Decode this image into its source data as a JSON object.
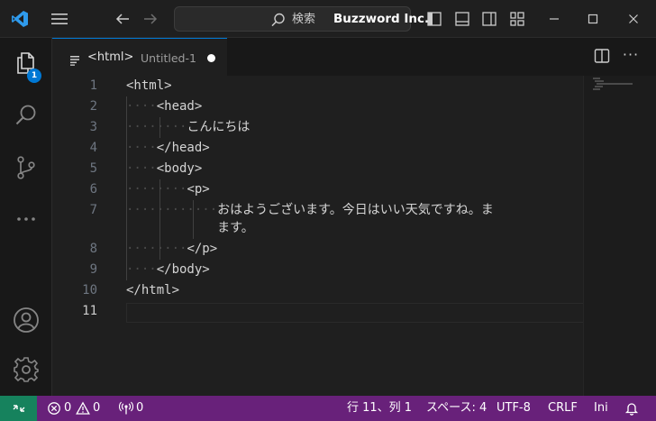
{
  "titlebar": {
    "search_label": "検索",
    "title": "Buzzword Inc."
  },
  "activity": {
    "explorer_badge": "1"
  },
  "tab": {
    "lang_label": "<html>",
    "file_name": "Untitled-1"
  },
  "editor": {
    "line_numbers": [
      "1",
      "2",
      "3",
      "4",
      "5",
      "6",
      "7",
      "",
      "8",
      "9",
      "10",
      "11"
    ],
    "lines": [
      {
        "indent": "",
        "text": "<html>"
      },
      {
        "indent": "····",
        "text": "<head>"
      },
      {
        "indent": "········",
        "text": "こんにちは"
      },
      {
        "indent": "····",
        "text": "</head>"
      },
      {
        "indent": "····",
        "text": "<body>"
      },
      {
        "indent": "········",
        "text": "<p>"
      },
      {
        "indent": "············",
        "text": "おはようございます。今日はいい天気ですね。ま"
      },
      {
        "indent": "            ",
        "text": "ます。"
      },
      {
        "indent": "········",
        "text": "</p>"
      },
      {
        "indent": "····",
        "text": "</body>"
      },
      {
        "indent": "",
        "text": "</html>"
      },
      {
        "indent": "",
        "text": ""
      }
    ]
  },
  "statusbar": {
    "errors": "0",
    "warnings": "0",
    "ports": "0",
    "position": "行 11、列 1",
    "spaces": "スペース: 4",
    "encoding": "UTF-8",
    "eol": "CRLF",
    "language": "Ini"
  },
  "colors": {
    "status_bg": "#68217a",
    "remote_bg": "#16825d",
    "accent": "#0078d4"
  }
}
